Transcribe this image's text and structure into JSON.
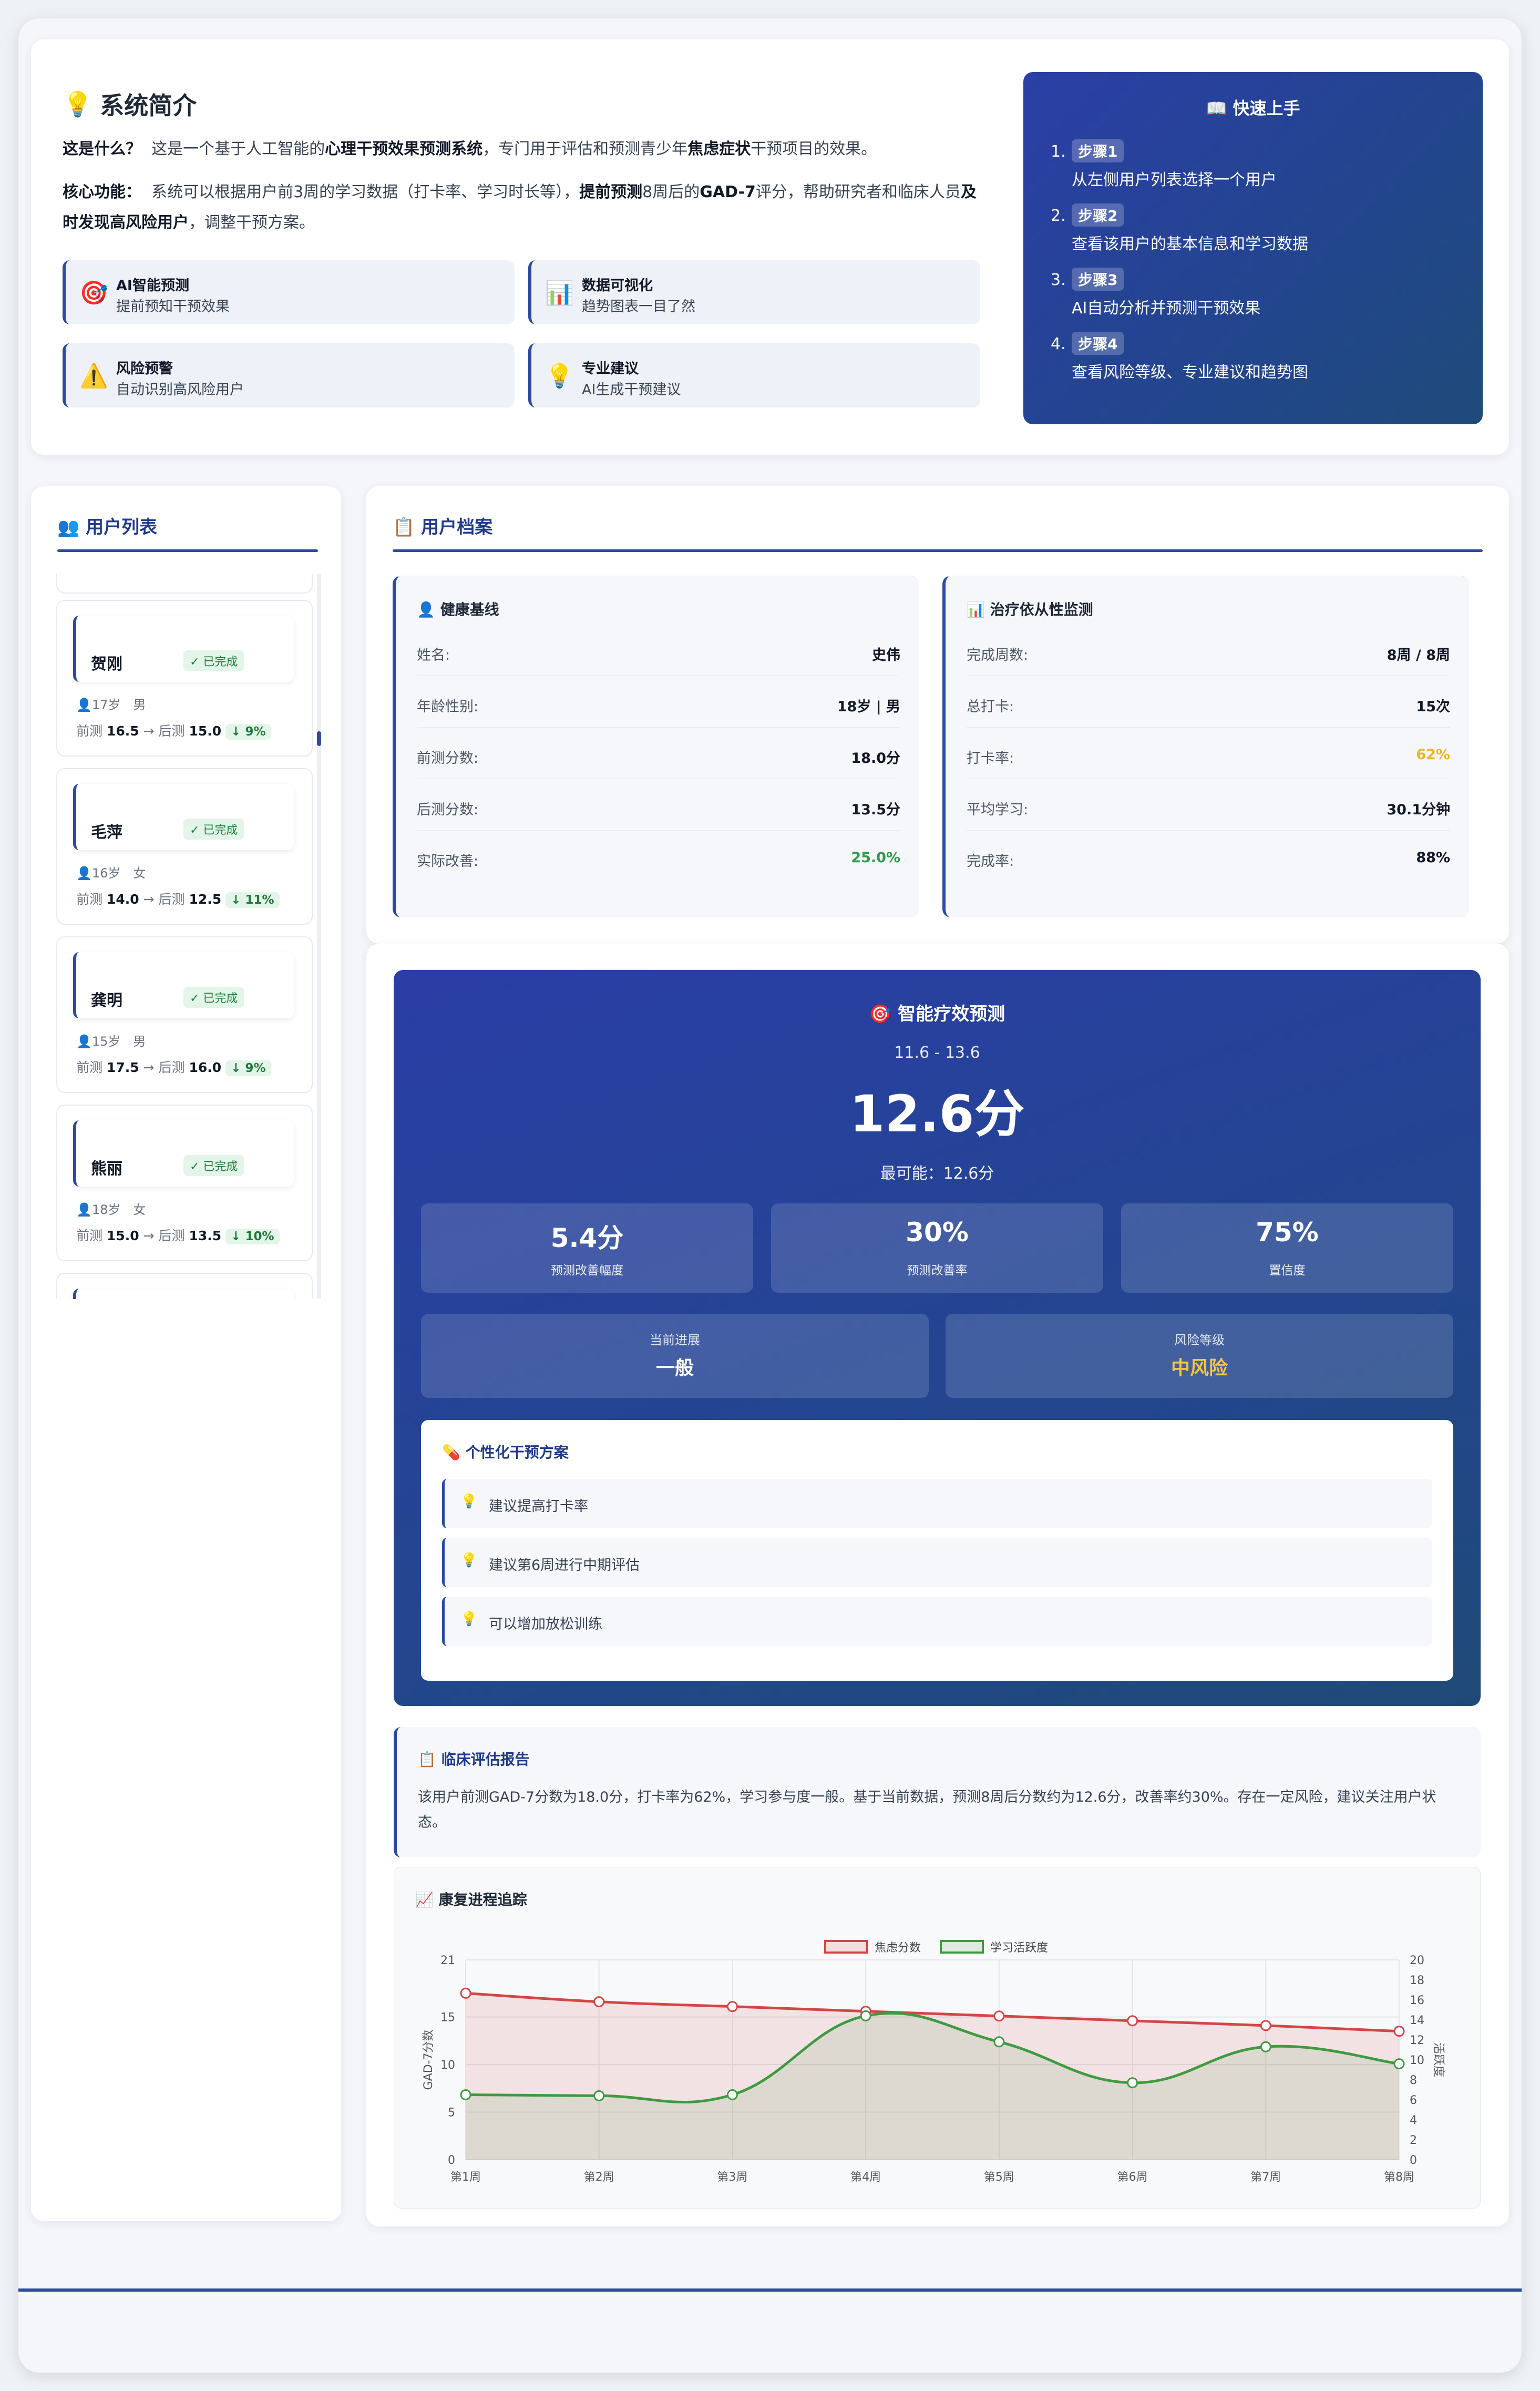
{
  "intro": {
    "title": "系统简介",
    "what_label": "这是什么？",
    "what_pre": "这是一个基于人工智能的",
    "what_bold": "心理干预效果预测系统",
    "what_mid": "，专门用于评估和预测青少年",
    "what_bold2": "焦虑症状",
    "what_post": "干预项目的效果。",
    "core_label": "核心功能：",
    "core_pre": "系统可以根据用户前3周的学习数据（打卡率、学习时长等），",
    "core_bold": "提前预测",
    "core_mid": "8周后的",
    "core_bold2": "GAD-7",
    "core_post": "评分，帮助研究者和临床人员",
    "core_bold3": "及时发现高风险用户",
    "core_end": "，调整干预方案。",
    "features": [
      {
        "icon": "🎯",
        "title": "AI智能预测",
        "desc": "提前预知干预效果"
      },
      {
        "icon": "📊",
        "title": "数据可视化",
        "desc": "趋势图表一目了然"
      },
      {
        "icon": "⚠️",
        "title": "风险预警",
        "desc": "自动识别高风险用户"
      },
      {
        "icon": "💡",
        "title": "专业建议",
        "desc": "AI生成干预建议"
      }
    ]
  },
  "quick_start": {
    "title": "📖 快速上手",
    "steps": [
      {
        "num": "1.",
        "badge": "步骤1",
        "desc": "从左侧用户列表选择一个用户"
      },
      {
        "num": "2.",
        "badge": "步骤2",
        "desc": "查看该用户的基本信息和学习数据"
      },
      {
        "num": "3.",
        "badge": "步骤3",
        "desc": "AI自动分析并预测干预效果"
      },
      {
        "num": "4.",
        "badge": "步骤4",
        "desc": "查看风险等级、专业建议和趋势图"
      }
    ]
  },
  "user_list": {
    "title": "👥 用户列表",
    "users": [
      {
        "name": "贺刚",
        "status": "✓ 已完成",
        "meta": "👤17岁　男",
        "pre_label": "前测",
        "pre": "16.5",
        "post_label": "后测",
        "post": "15.0",
        "change": "↓ 9%"
      },
      {
        "name": "毛萍",
        "status": "✓ 已完成",
        "meta": "👤16岁　女",
        "pre_label": "前测",
        "pre": "14.0",
        "post_label": "后测",
        "post": "12.5",
        "change": "↓ 11%"
      },
      {
        "name": "龚明",
        "status": "✓ 已完成",
        "meta": "👤15岁　男",
        "pre_label": "前测",
        "pre": "17.5",
        "post_label": "后测",
        "post": "16.0",
        "change": "↓ 9%"
      },
      {
        "name": "熊丽",
        "status": "✓ 已完成",
        "meta": "👤18岁　女",
        "pre_label": "前测",
        "pre": "15.0",
        "post_label": "后测",
        "post": "13.5",
        "change": "↓ 10%"
      }
    ]
  },
  "profile": {
    "title": "📋 用户档案",
    "baseline": {
      "title": "👤 健康基线",
      "rows": [
        {
          "k": "姓名:",
          "v": "史伟"
        },
        {
          "k": "年龄性别:",
          "v": "18岁 | 男"
        },
        {
          "k": "前测分数:",
          "v": "18.0分"
        },
        {
          "k": "后测分数:",
          "v": "13.5分"
        },
        {
          "k": "实际改善:",
          "v": "25.0%"
        }
      ]
    },
    "adherence": {
      "title": "📊 治疗依从性监测",
      "rows": [
        {
          "k": "完成周数:",
          "v": "8周 / 8周"
        },
        {
          "k": "总打卡:",
          "v": "15次"
        },
        {
          "k": "打卡率:",
          "v": "62%"
        },
        {
          "k": "平均学习:",
          "v": "30.1分钟"
        },
        {
          "k": "完成率:",
          "v": "88%"
        }
      ]
    }
  },
  "prediction": {
    "title": "🎯 智能疗效预测",
    "range": "11.6 - 13.6",
    "score": "12.6分",
    "likely": "最可能：12.6分",
    "stats": [
      {
        "value": "5.4分",
        "label": "预测改善幅度"
      },
      {
        "value": "30%",
        "label": "预测改善率"
      },
      {
        "value": "75%",
        "label": "置信度"
      }
    ],
    "progress_label": "当前进展",
    "progress_value": "一般",
    "risk_label": "风险等级",
    "risk_value": "中风险",
    "risk_color": "#f5c542",
    "plan_title": "💊 个性化干预方案",
    "suggestions": [
      "建议提高打卡率",
      "建议第6周进行中期评估",
      "可以增加放松训练"
    ]
  },
  "report": {
    "title": "📋 临床评估报告",
    "text": "该用户前测GAD-7分数为18.0分，打卡率为62%，学习参与度一般。基于当前数据，预测8周后分数约为12.6分，改善率约30%。存在一定风险，建议关注用户状态。"
  },
  "chart_title": "📈 康复进程追踪",
  "chart_data": {
    "type": "line",
    "categories": [
      "第1周",
      "第2周",
      "第3周",
      "第4周",
      "第5周",
      "第6周",
      "第7周",
      "第8周"
    ],
    "series": [
      {
        "name": "焦虑分数",
        "axis": "left",
        "color": "#d64545",
        "values": [
          17.5,
          16.6,
          16.1,
          15.6,
          15.1,
          14.6,
          14.1,
          13.5
        ]
      },
      {
        "name": "学习活跃度",
        "axis": "right",
        "color": "#3f9a3f",
        "values": [
          6.5,
          6.4,
          6.5,
          14.4,
          11.8,
          7.7,
          11.3,
          9.6
        ]
      }
    ],
    "ylabel": "GAD-7分数",
    "ylabel_right": "活跃度",
    "ylim": [
      0,
      21
    ],
    "yticks": [
      0,
      5,
      10,
      15,
      21
    ],
    "ylim_right": [
      0,
      20
    ],
    "yticks_right": [
      0,
      2,
      4,
      6,
      8,
      10,
      12,
      14,
      16,
      18,
      20
    ],
    "grid": true,
    "legend": "top-center"
  }
}
